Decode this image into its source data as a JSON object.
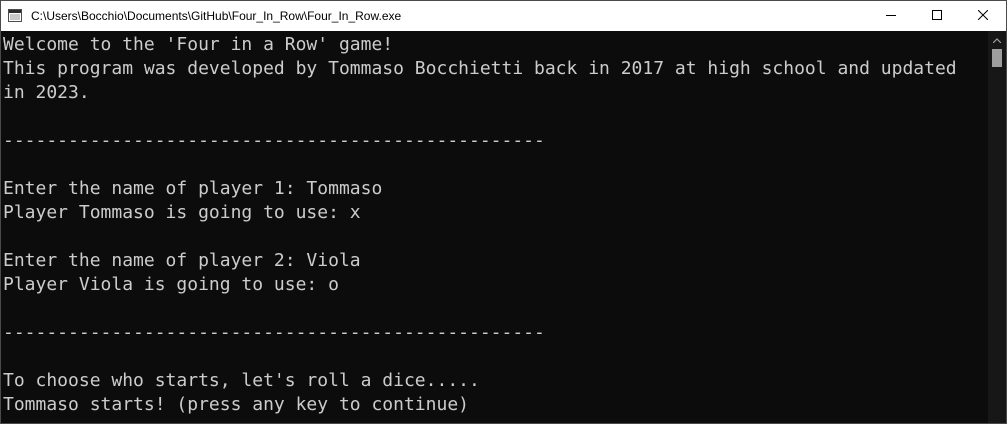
{
  "window": {
    "title": "C:\\Users\\Bocchio\\Documents\\GitHub\\Four_In_Row\\Four_In_Row.exe",
    "app_icon": "console-app-icon",
    "controls": {
      "minimize_icon": "minimize-icon",
      "maximize_icon": "maximize-icon",
      "close_icon": "close-icon"
    }
  },
  "console": {
    "lines": [
      "Welcome to the 'Four in a Row' game!",
      "This program was developed by Tommaso Bocchietti back in 2017 at high school and updated",
      "in 2023.",
      "",
      "--------------------------------------------------",
      "",
      "Enter the name of player 1: Tommaso",
      "Player Tommaso is going to use: x",
      "",
      "Enter the name of player 2: Viola",
      "Player Viola is going to use: o",
      "",
      "--------------------------------------------------",
      "",
      "To choose who starts, let's roll a dice.....",
      "Tommaso starts! (press any key to continue)"
    ]
  },
  "colors": {
    "console_background": "#0c0c0c",
    "console_text": "#cccccc",
    "titlebar_background": "#ffffff"
  }
}
